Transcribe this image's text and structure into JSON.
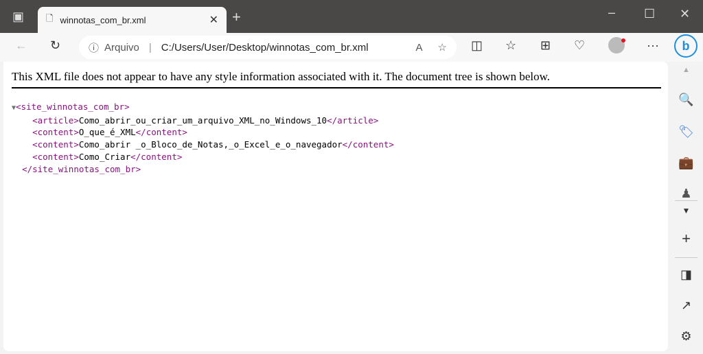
{
  "tab": {
    "title": "winnotas_com_br.xml"
  },
  "address": {
    "site_info": "Arquivo",
    "url": "C:/Users/User/Desktop/winnotas_com_br.xml"
  },
  "notice": "This XML file does not appear to have any style information associated with it. The document tree is shown below.",
  "xml": {
    "root_open": "<site_winnotas_com_br>",
    "lines": [
      {
        "open": "<article>",
        "text": "Como_abrir_ou_criar_um_arquivo_XML_no_Windows_10",
        "close": "</article>"
      },
      {
        "open": "<content>",
        "text": "O_que_é_XML",
        "close": "</content>"
      },
      {
        "open": "<content>",
        "text": "Como_abrir _o_Bloco_de_Notas,_o_Excel_e_o_navegador",
        "close": "</content>"
      },
      {
        "open": "<content>",
        "text": "Como_Criar",
        "close": "</content>"
      }
    ],
    "root_close": "</site_winnotas_com_br>"
  }
}
